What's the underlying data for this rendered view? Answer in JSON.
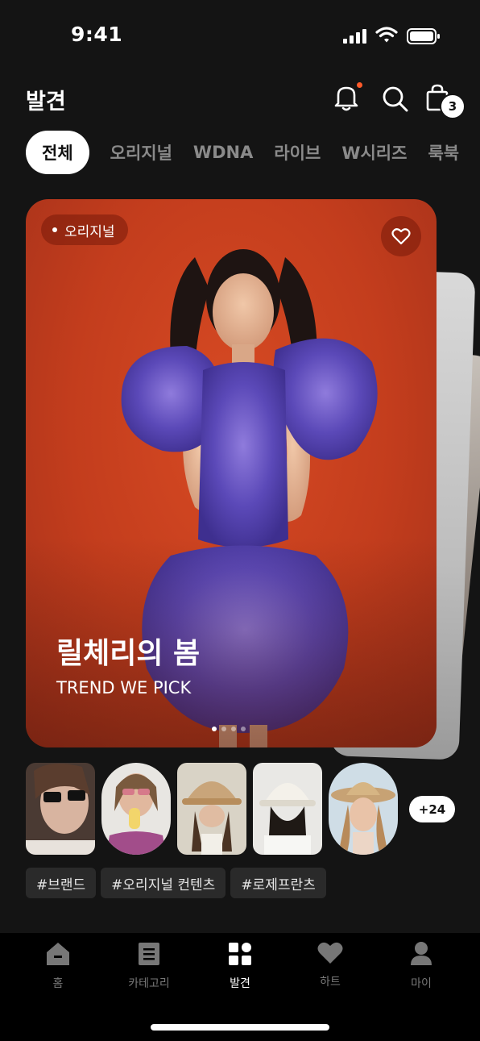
{
  "status_bar": {
    "time": "9:41"
  },
  "header": {
    "title": "발견",
    "cart_count": "3"
  },
  "tabs": [
    {
      "label": "전체",
      "active": true
    },
    {
      "label": "오리지널"
    },
    {
      "label": "WDNA"
    },
    {
      "label": "라이브"
    },
    {
      "label": "W시리즈"
    },
    {
      "label": "룩북"
    }
  ],
  "feature_card": {
    "badge": "오리지널",
    "title": "릴체리의 봄",
    "subtitle": "TREND WE PICK",
    "page_count": 4,
    "current_page": 1,
    "bg_color": "#c83f1e"
  },
  "thumbnails": {
    "more_label": "+24"
  },
  "tags": [
    "#브랜드",
    "#오리지널 컨텐츠",
    "#로제프란츠"
  ],
  "bottom_nav": [
    {
      "label": "홈",
      "icon": "home-icon"
    },
    {
      "label": "카테고리",
      "icon": "list-icon"
    },
    {
      "label": "발견",
      "icon": "grid-icon",
      "active": true
    },
    {
      "label": "하트",
      "icon": "heart-icon"
    },
    {
      "label": "마이",
      "icon": "person-icon"
    }
  ]
}
